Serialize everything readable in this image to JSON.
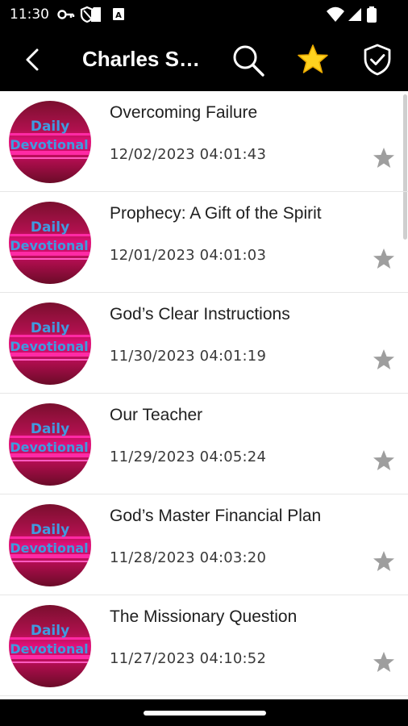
{
  "status_bar": {
    "time": "11:30",
    "icons": [
      "vpn-key-icon",
      "shield-status-icon",
      "sd-card-icon",
      "app-notification-icon",
      "wifi-icon",
      "signal-icon",
      "battery-icon"
    ]
  },
  "app_bar": {
    "title": "Charles St...",
    "back_icon": "back-arrow-icon",
    "search_icon": "search-icon",
    "favorite_icon": "star-icon",
    "privacy_icon": "shield-check-icon"
  },
  "avatar": {
    "line1": "Daily",
    "line2": "Devotional"
  },
  "items": [
    {
      "title": "Overcoming Failure",
      "date": "12/02/2023 04:01:43"
    },
    {
      "title": "Prophecy: A Gift of the Spirit",
      "date": "12/01/2023 04:01:03"
    },
    {
      "title": "God’s Clear Instructions",
      "date": "11/30/2023 04:01:19"
    },
    {
      "title": "Our Teacher",
      "date": "11/29/2023 04:05:24"
    },
    {
      "title": "God’s Master Financial Plan",
      "date": "11/28/2023 04:03:20"
    },
    {
      "title": "The Missionary Question",
      "date": "11/27/2023 04:10:52"
    }
  ],
  "colors": {
    "star_favorite": "#FFD21F",
    "star_inactive": "#9E9E9E",
    "avatar_magenta": "#E0107A",
    "avatar_text": "#3F9BE0"
  }
}
